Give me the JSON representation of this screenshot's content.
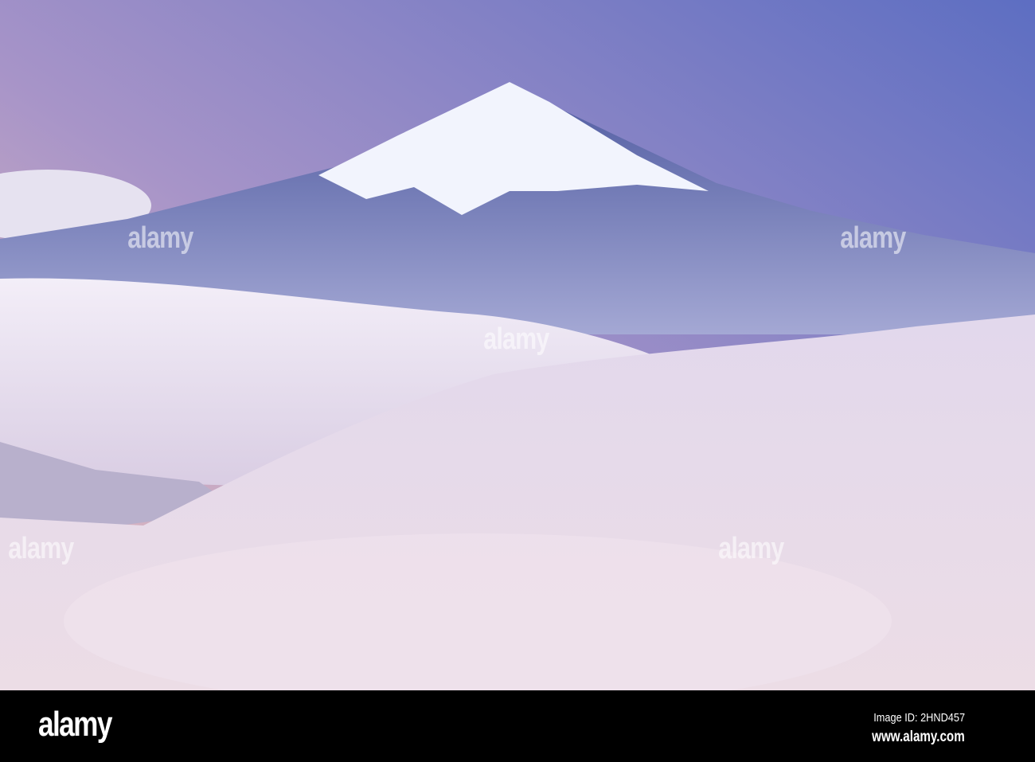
{
  "watermark": {
    "brand": "alamy"
  },
  "footer": {
    "logo": "alamy",
    "image_id": "Image ID: 2HND457",
    "url": "www.alamy.com"
  },
  "colors": {
    "sky_top": "#6a78c4",
    "sky_horizon": "#f0c4c0",
    "mountain": "#5e6aa8",
    "snow": "#f4f6ff",
    "forest": "#e8dcea"
  }
}
